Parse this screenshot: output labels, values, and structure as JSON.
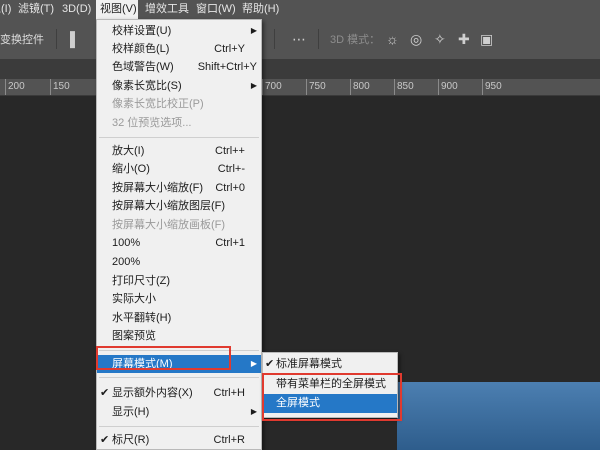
{
  "menubar": {
    "items": [
      {
        "label": "滤镜(T)"
      },
      {
        "label": "3D(D)"
      },
      {
        "label": "视图(V)"
      },
      {
        "label": "增效工具"
      },
      {
        "label": "窗口(W)"
      },
      {
        "label": "帮助(H)"
      }
    ],
    "leading_label": "像(I)"
  },
  "options_bar": {
    "transform_label": "变换控件",
    "mode_3d_label": "3D 模式："
  },
  "ruler": {
    "labels": [
      "200",
      "150",
      "700",
      "750",
      "800",
      "850",
      "900",
      "950"
    ]
  },
  "view_menu": {
    "items": [
      {
        "label": "校样设置(U)",
        "shortcut": "",
        "submenu": true,
        "disabled": false
      },
      {
        "label": "校样颜色(L)",
        "shortcut": "Ctrl+Y",
        "submenu": false,
        "disabled": false
      },
      {
        "label": "色域警告(W)",
        "shortcut": "Shift+Ctrl+Y",
        "submenu": false,
        "disabled": false
      },
      {
        "label": "像素长宽比(S)",
        "shortcut": "",
        "submenu": true,
        "disabled": false
      },
      {
        "label": "像素长宽比校正(P)",
        "shortcut": "",
        "submenu": false,
        "disabled": true
      },
      {
        "label": "32 位预览选项...",
        "shortcut": "",
        "submenu": false,
        "disabled": true
      },
      {
        "label": "放大(I)",
        "shortcut": "Ctrl++",
        "submenu": false,
        "disabled": false
      },
      {
        "label": "缩小(O)",
        "shortcut": "Ctrl+-",
        "submenu": false,
        "disabled": false
      },
      {
        "label": "按屏幕大小缩放(F)",
        "shortcut": "Ctrl+0",
        "submenu": false,
        "disabled": false
      },
      {
        "label": "按屏幕大小缩放图层(F)",
        "shortcut": "",
        "submenu": false,
        "disabled": false
      },
      {
        "label": "按屏幕大小缩放画板(F)",
        "shortcut": "",
        "submenu": false,
        "disabled": true
      },
      {
        "label": "100%",
        "shortcut": "Ctrl+1",
        "submenu": false,
        "disabled": false
      },
      {
        "label": "200%",
        "shortcut": "",
        "submenu": false,
        "disabled": false
      },
      {
        "label": "打印尺寸(Z)",
        "shortcut": "",
        "submenu": false,
        "disabled": false
      },
      {
        "label": "实际大小",
        "shortcut": "",
        "submenu": false,
        "disabled": false
      },
      {
        "label": "水平翻转(H)",
        "shortcut": "",
        "submenu": false,
        "disabled": false
      },
      {
        "label": "图案预览",
        "shortcut": "",
        "submenu": false,
        "disabled": false
      },
      {
        "label": "屏幕模式(M)",
        "shortcut": "",
        "submenu": true,
        "disabled": false
      },
      {
        "label": "显示额外内容(X)",
        "shortcut": "Ctrl+H",
        "submenu": false,
        "disabled": false,
        "checked": true
      },
      {
        "label": "显示(H)",
        "shortcut": "",
        "submenu": true,
        "disabled": false
      },
      {
        "label": "标尺(R)",
        "shortcut": "Ctrl+R",
        "submenu": false,
        "disabled": false,
        "checked": true
      }
    ]
  },
  "screen_mode_submenu": {
    "items": [
      {
        "label": "标准屏幕模式",
        "checked": true
      },
      {
        "label": "带有菜单栏的全屏模式",
        "checked": false
      },
      {
        "label": "全屏模式",
        "checked": false
      }
    ]
  },
  "colors": {
    "highlight": "#2578c7",
    "annotation_red": "#e03a2f",
    "panel": "#535353",
    "menu_bg": "#f0f0f0"
  }
}
